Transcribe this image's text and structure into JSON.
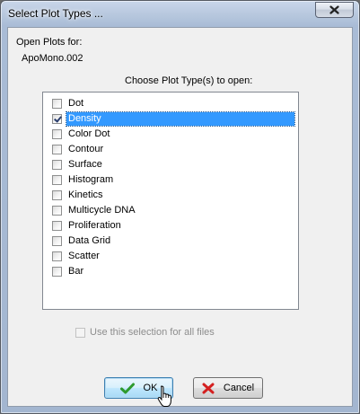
{
  "window": {
    "title": "Select Plot Types ...",
    "close_icon": "close-icon"
  },
  "dialog": {
    "open_plots_label": "Open Plots for:",
    "file_name": "ApoMono.002",
    "choose_label": "Choose Plot Type(s) to open:",
    "plot_types": [
      {
        "label": "Dot",
        "checked": false,
        "selected": false
      },
      {
        "label": "Density",
        "checked": true,
        "selected": true
      },
      {
        "label": "Color Dot",
        "checked": false,
        "selected": false
      },
      {
        "label": "Contour",
        "checked": false,
        "selected": false
      },
      {
        "label": "Surface",
        "checked": false,
        "selected": false
      },
      {
        "label": "Histogram",
        "checked": false,
        "selected": false
      },
      {
        "label": "Kinetics",
        "checked": false,
        "selected": false
      },
      {
        "label": "Multicycle DNA",
        "checked": false,
        "selected": false
      },
      {
        "label": "Proliferation",
        "checked": false,
        "selected": false
      },
      {
        "label": "Data Grid",
        "checked": false,
        "selected": false
      },
      {
        "label": "Scatter",
        "checked": false,
        "selected": false
      },
      {
        "label": "Bar",
        "checked": false,
        "selected": false
      }
    ],
    "use_for_all_label": "Use this selection for all files",
    "use_for_all_checked": false,
    "use_for_all_enabled": false
  },
  "buttons": {
    "ok_label": "OK",
    "ok_icon": "checkmark-icon",
    "cancel_label": "Cancel",
    "cancel_icon": "x-icon"
  },
  "colors": {
    "selection": "#3399ff",
    "ok_check": "#2e9a2e",
    "cancel_x": "#d42020"
  }
}
